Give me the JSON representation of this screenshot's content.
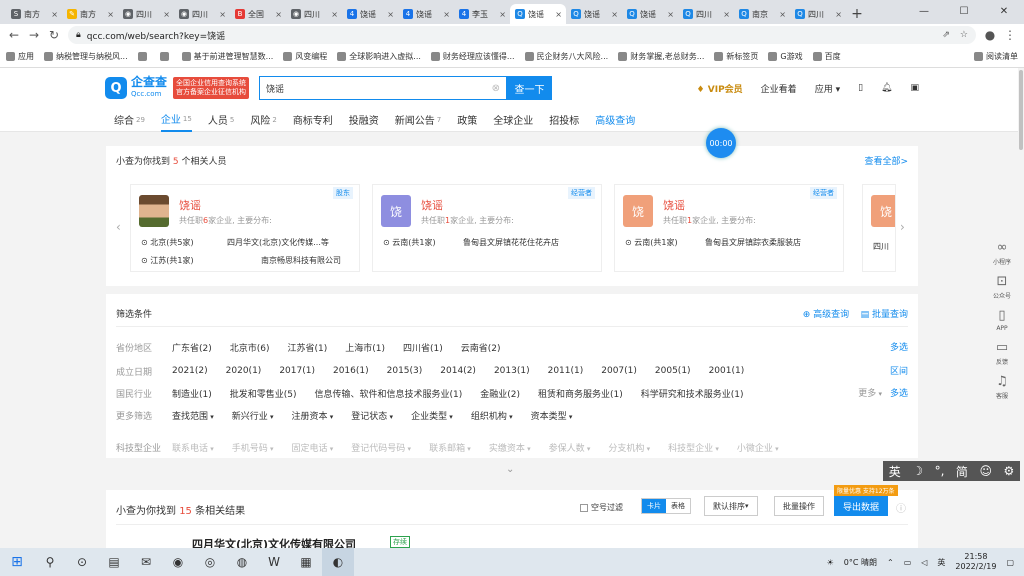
{
  "browser": {
    "tabs": [
      {
        "label": "南方",
        "color": "#5f6368",
        "glyph": "S"
      },
      {
        "label": "南方",
        "color": "#f5b400",
        "glyph": "✎"
      },
      {
        "label": "四川",
        "color": "#5f6368",
        "glyph": "◉"
      },
      {
        "label": "四川",
        "color": "#5f6368",
        "glyph": "◉"
      },
      {
        "label": "全国",
        "color": "#e53935",
        "glyph": "B"
      },
      {
        "label": "四川",
        "color": "#5f6368",
        "glyph": "◉"
      },
      {
        "label": "饶谣",
        "color": "#1a73e8",
        "glyph": "4"
      },
      {
        "label": "饶谣",
        "color": "#1a73e8",
        "glyph": "4"
      },
      {
        "label": "李玉",
        "color": "#1a73e8",
        "glyph": "4"
      },
      {
        "label": "饶谣",
        "color": "#1e88e5",
        "glyph": "Q"
      },
      {
        "label": "饶谣",
        "color": "#1e88e5",
        "glyph": "Q"
      },
      {
        "label": "饶谣",
        "color": "#1e88e5",
        "glyph": "Q"
      },
      {
        "label": "四川",
        "color": "#1e88e5",
        "glyph": "Q"
      },
      {
        "label": "南京",
        "color": "#1e88e5",
        "glyph": "Q"
      },
      {
        "label": "四川",
        "color": "#1e88e5",
        "glyph": "Q"
      }
    ],
    "active_tab": 9,
    "url": "qcc.com/web/search?key=饶谣",
    "bookmarks": [
      "应用",
      "纳税管理与纳税风...",
      "",
      "",
      "基于前进管理智慧数...",
      "风变编程",
      "全球影响进入虚拟...",
      "财务经理应该懂得...",
      "民企财务八大风险...",
      "财务掌握,老总财务...",
      "新标签页",
      "G游戏",
      "百度"
    ],
    "bookmarks_right": "阅读清单"
  },
  "site": {
    "logo_cn": "企查查",
    "logo_en": "Qcc.com",
    "badge_line1": "全国企业信用查询系统",
    "badge_line2": "官方备案企业征信机构",
    "search_value": "饶谣",
    "search_button": "查一下",
    "vip": "VIP会员",
    "enterprise_kanban": "企业看着",
    "apps": "应用"
  },
  "subnav": [
    {
      "label": "综合",
      "count": "29"
    },
    {
      "label": "企业",
      "count": "15"
    },
    {
      "label": "人员",
      "count": "5"
    },
    {
      "label": "风险",
      "count": "2"
    },
    {
      "label": "商标专利",
      "count": ""
    },
    {
      "label": "投融资",
      "count": ""
    },
    {
      "label": "新闻公告",
      "count": "7"
    },
    {
      "label": "政策",
      "count": ""
    },
    {
      "label": "全球企业",
      "count": ""
    },
    {
      "label": "招投标",
      "count": ""
    },
    {
      "label": "高级查询",
      "count": ""
    }
  ],
  "people": {
    "prefix": "小查为你找到",
    "count": "5",
    "suffix": "个相关人员",
    "view_all": "查看全部>",
    "timer": "00:00",
    "cards": [
      {
        "name": "饶谣",
        "avatar_text": "",
        "avatar_color": "#556b2f",
        "tag": "股东",
        "desc_pre": "共任职",
        "desc_num": "6",
        "desc_post": "家企业, 主要分布:",
        "r1a": "北京(共5家)",
        "r1b": "四月华文(北京)文化传媒...等",
        "r2a": "江苏(共1家)",
        "r2b": "南京畅思科技有限公司"
      },
      {
        "name": "饶谣",
        "avatar_text": "饶",
        "avatar_color": "#8e8ee0",
        "tag": "经营者",
        "desc_pre": "共任职",
        "desc_num": "1",
        "desc_post": "家企业, 主要分布:",
        "r1a": "云南(共1家)",
        "r1b": "鲁甸县文屏镇花花住花卉店",
        "r2a": "",
        "r2b": ""
      },
      {
        "name": "饶谣",
        "avatar_text": "饶",
        "avatar_color": "#f0a07a",
        "tag": "经营者",
        "desc_pre": "共任职",
        "desc_num": "1",
        "desc_post": "家企业, 主要分布:",
        "r1a": "云南(共1家)",
        "r1b": "鲁甸县文屏镇踪衣柔服装店",
        "r2a": "",
        "r2b": ""
      }
    ],
    "partial_card_row": "四川"
  },
  "filters": {
    "title": "筛选条件",
    "advanced": "高级查询",
    "batch": "批量查询",
    "rows": [
      {
        "label": "省份地区",
        "options": [
          "广东省(2)",
          "北京市(6)",
          "江苏省(1)",
          "上海市(1)",
          "四川省(1)",
          "云南省(2)"
        ],
        "right": "多选"
      },
      {
        "label": "成立日期",
        "options": [
          "2021(2)",
          "2020(1)",
          "2017(1)",
          "2016(1)",
          "2015(3)",
          "2014(2)",
          "2013(1)",
          "2011(1)",
          "2007(1)",
          "2005(1)",
          "2001(1)"
        ],
        "right": "区间"
      },
      {
        "label": "国民行业",
        "options": [
          "制造业(1)",
          "批发和零售业(5)",
          "信息传输、软件和信息技术服务业(1)",
          "金融业(2)",
          "租赁和商务服务业(1)",
          "科学研究和技术服务业(1)"
        ],
        "right": "多选",
        "more": "更多"
      },
      {
        "label": "更多筛选",
        "options": [
          "查找范围",
          "新兴行业",
          "注册资本",
          "登记状态",
          "企业类型",
          "组织机构",
          "资本类型"
        ]
      },
      {
        "label": "科技型企业",
        "options": [
          "联系电话",
          "手机号码",
          "固定电话",
          "登记代码号码",
          "联系邮箱",
          "实缴资本",
          "参保人数",
          "分支机构",
          "科技型企业",
          "小微企业"
        ]
      }
    ]
  },
  "results": {
    "prefix": "小查为你找到",
    "count": "15",
    "suffix": "条相关结果",
    "empty_filter": "空号过滤",
    "view_card": "卡片",
    "view_table": "表格",
    "sort": "默认排序",
    "batch_ops": "批量操作",
    "export": "导出数据",
    "promo": "限量优惠 支持12万条",
    "first_company": "四月华文(北京)文化传媒有限公司",
    "first_tag": "存续"
  },
  "right_rail": [
    "小程序",
    "公众号",
    "APP",
    "反馈",
    "客服"
  ],
  "ime": [
    "英",
    "☽",
    "°,",
    "简",
    "☺",
    "⚙"
  ],
  "taskbar": {
    "apps": [
      "⊙",
      "▤",
      "✉",
      "◉",
      "◎",
      "◍",
      "W",
      "▦",
      "◐"
    ],
    "weather": "0°C 晴朗",
    "lang": "英",
    "time": "21:58",
    "date": "2022/2/19"
  },
  "colors": {
    "brand": "#128bed",
    "accent_red": "#e74c3c"
  }
}
